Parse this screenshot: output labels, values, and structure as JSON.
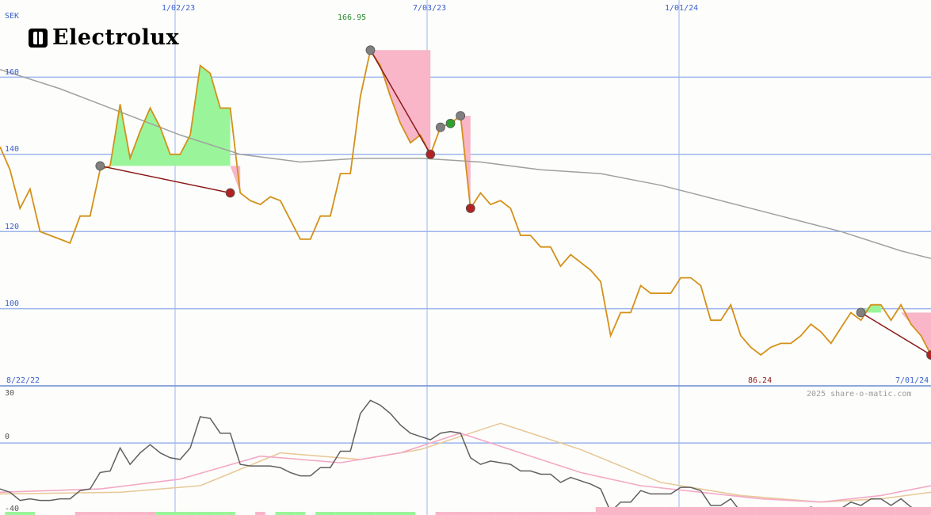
{
  "brand": {
    "name": "Electrolux"
  },
  "chart_data": [
    {
      "type": "line",
      "currency_label": "SEK",
      "x_dates": [
        "1/02/23",
        "7/03/23",
        "1/01/24"
      ],
      "start_date": "8/22/22",
      "end_date": "7/01/24",
      "max_label": "166.95",
      "min_label": "86.24",
      "watermark": "2025 share-o-matic.com",
      "ylim": [
        80,
        180
      ],
      "yticks": [
        160,
        140,
        120,
        100
      ],
      "price": [
        [
          0,
          142
        ],
        [
          1,
          136
        ],
        [
          2,
          126
        ],
        [
          3,
          131
        ],
        [
          4,
          120
        ],
        [
          5,
          119
        ],
        [
          6,
          118
        ],
        [
          7,
          117
        ],
        [
          8,
          124
        ],
        [
          9,
          124
        ],
        [
          10,
          136
        ],
        [
          11,
          137
        ],
        [
          12,
          153
        ],
        [
          13,
          139
        ],
        [
          14,
          146
        ],
        [
          15,
          152
        ],
        [
          16,
          147
        ],
        [
          17,
          140
        ],
        [
          18,
          140
        ],
        [
          19,
          145
        ],
        [
          20,
          163
        ],
        [
          21,
          161
        ],
        [
          22,
          152
        ],
        [
          23,
          152
        ],
        [
          24,
          130
        ],
        [
          25,
          128
        ],
        [
          26,
          127
        ],
        [
          27,
          129
        ],
        [
          28,
          128
        ],
        [
          29,
          123
        ],
        [
          30,
          118
        ],
        [
          31,
          118
        ],
        [
          32,
          124
        ],
        [
          33,
          124
        ],
        [
          34,
          135
        ],
        [
          35,
          135
        ],
        [
          36,
          155
        ],
        [
          37,
          167
        ],
        [
          38,
          163
        ],
        [
          39,
          155
        ],
        [
          40,
          148
        ],
        [
          41,
          143
        ],
        [
          42,
          145
        ],
        [
          43,
          140
        ],
        [
          44,
          147
        ],
        [
          45,
          148
        ],
        [
          46,
          150
        ],
        [
          47,
          126
        ],
        [
          48,
          130
        ],
        [
          49,
          127
        ],
        [
          50,
          128
        ],
        [
          51,
          126
        ],
        [
          52,
          119
        ],
        [
          53,
          119
        ],
        [
          54,
          116
        ],
        [
          55,
          116
        ],
        [
          56,
          111
        ],
        [
          57,
          114
        ],
        [
          58,
          112
        ],
        [
          59,
          110
        ],
        [
          60,
          107
        ],
        [
          61,
          93
        ],
        [
          62,
          99
        ],
        [
          63,
          99
        ],
        [
          64,
          106
        ],
        [
          65,
          104
        ],
        [
          66,
          104
        ],
        [
          67,
          104
        ],
        [
          68,
          108
        ],
        [
          69,
          108
        ],
        [
          70,
          106
        ],
        [
          71,
          97
        ],
        [
          72,
          97
        ],
        [
          73,
          101
        ],
        [
          74,
          93
        ],
        [
          75,
          90
        ],
        [
          76,
          88
        ],
        [
          77,
          90
        ],
        [
          78,
          91
        ],
        [
          79,
          91
        ],
        [
          80,
          93
        ],
        [
          81,
          96
        ],
        [
          82,
          94
        ],
        [
          83,
          91
        ],
        [
          84,
          95
        ],
        [
          85,
          99
        ],
        [
          86,
          97
        ],
        [
          87,
          101
        ],
        [
          88,
          101
        ],
        [
          89,
          97
        ],
        [
          90,
          101
        ],
        [
          91,
          96
        ],
        [
          92,
          93
        ],
        [
          93,
          88
        ]
      ],
      "moving_average": [
        [
          0,
          162
        ],
        [
          6,
          157
        ],
        [
          12,
          151
        ],
        [
          18,
          145
        ],
        [
          24,
          140
        ],
        [
          30,
          138
        ],
        [
          36,
          139
        ],
        [
          42,
          139
        ],
        [
          48,
          138
        ],
        [
          54,
          136
        ],
        [
          60,
          135
        ],
        [
          66,
          132
        ],
        [
          72,
          128
        ],
        [
          78,
          124
        ],
        [
          84,
          120
        ],
        [
          90,
          115
        ],
        [
          93,
          113
        ]
      ],
      "gain_regions": [
        {
          "x_start": 10,
          "x_end": 23,
          "baseline": 137
        },
        {
          "x_start": 86,
          "x_end": 88,
          "baseline": 99
        }
      ],
      "loss_regions": [
        {
          "x_start": 37,
          "x_end": 43,
          "top": 167
        },
        {
          "x_start": 46,
          "x_end": 47,
          "top": 150
        },
        {
          "x_start": 23,
          "x_end": 24,
          "top": 137
        },
        {
          "x_start": 90,
          "x_end": 93,
          "top": 99
        }
      ],
      "markers": [
        {
          "x": 10,
          "y": 137,
          "kind": "buy"
        },
        {
          "x": 23,
          "y": 130,
          "kind": "sell"
        },
        {
          "x": 37,
          "y": 167,
          "kind": "buy"
        },
        {
          "x": 43,
          "y": 140,
          "kind": "sell"
        },
        {
          "x": 44,
          "y": 147,
          "kind": "buy"
        },
        {
          "x": 45,
          "y": 148,
          "kind": "signal"
        },
        {
          "x": 46,
          "y": 150,
          "kind": "buy"
        },
        {
          "x": 47,
          "y": 126,
          "kind": "sell"
        },
        {
          "x": 86,
          "y": 99,
          "kind": "buy"
        },
        {
          "x": 93,
          "y": 88,
          "kind": "sell"
        }
      ],
      "trend_lines": [
        {
          "from": [
            10,
            137
          ],
          "to": [
            23,
            130
          ]
        },
        {
          "from": [
            37,
            167
          ],
          "to": [
            43,
            140
          ]
        },
        {
          "from": [
            86,
            99
          ],
          "to": [
            93,
            88
          ]
        }
      ]
    },
    {
      "type": "line",
      "ylim": [
        -40,
        30
      ],
      "yticks": [
        30,
        0,
        -40
      ],
      "oscillator": [
        [
          0,
          -28
        ],
        [
          1,
          -30
        ],
        [
          2,
          -35
        ],
        [
          3,
          -34
        ],
        [
          4,
          -35
        ],
        [
          5,
          -35
        ],
        [
          6,
          -34
        ],
        [
          7,
          -34
        ],
        [
          8,
          -29
        ],
        [
          9,
          -28
        ],
        [
          10,
          -18
        ],
        [
          11,
          -17
        ],
        [
          12,
          -3
        ],
        [
          13,
          -13
        ],
        [
          14,
          -6
        ],
        [
          15,
          -1
        ],
        [
          16,
          -6
        ],
        [
          17,
          -9
        ],
        [
          18,
          -10
        ],
        [
          19,
          -3
        ],
        [
          20,
          16
        ],
        [
          21,
          15
        ],
        [
          22,
          6
        ],
        [
          23,
          6
        ],
        [
          24,
          -13
        ],
        [
          25,
          -14
        ],
        [
          26,
          -14
        ],
        [
          27,
          -14
        ],
        [
          28,
          -15
        ],
        [
          29,
          -18
        ],
        [
          30,
          -20
        ],
        [
          31,
          -20
        ],
        [
          32,
          -15
        ],
        [
          33,
          -15
        ],
        [
          34,
          -5
        ],
        [
          35,
          -5
        ],
        [
          36,
          18
        ],
        [
          37,
          26
        ],
        [
          38,
          23
        ],
        [
          39,
          18
        ],
        [
          40,
          11
        ],
        [
          41,
          6
        ],
        [
          42,
          4
        ],
        [
          43,
          2
        ],
        [
          44,
          6
        ],
        [
          45,
          7
        ],
        [
          46,
          6
        ],
        [
          47,
          -9
        ],
        [
          48,
          -13
        ],
        [
          49,
          -11
        ],
        [
          50,
          -12
        ],
        [
          51,
          -13
        ],
        [
          52,
          -17
        ],
        [
          53,
          -17
        ],
        [
          54,
          -19
        ],
        [
          55,
          -19
        ],
        [
          56,
          -24
        ],
        [
          57,
          -21
        ],
        [
          58,
          -23
        ],
        [
          59,
          -25
        ],
        [
          60,
          -28
        ],
        [
          61,
          -42
        ],
        [
          62,
          -36
        ],
        [
          63,
          -36
        ],
        [
          64,
          -29
        ],
        [
          65,
          -31
        ],
        [
          66,
          -31
        ],
        [
          67,
          -31
        ],
        [
          68,
          -27
        ],
        [
          69,
          -27
        ],
        [
          70,
          -29
        ],
        [
          71,
          -38
        ],
        [
          72,
          -38
        ],
        [
          73,
          -34
        ],
        [
          74,
          -42
        ],
        [
          75,
          -45
        ],
        [
          76,
          -47
        ],
        [
          77,
          -45
        ],
        [
          78,
          -44
        ],
        [
          79,
          -44
        ],
        [
          80,
          -42
        ],
        [
          81,
          -39
        ],
        [
          82,
          -41
        ],
        [
          83,
          -44
        ],
        [
          84,
          -40
        ],
        [
          85,
          -36
        ],
        [
          86,
          -38
        ],
        [
          87,
          -34
        ],
        [
          88,
          -34
        ],
        [
          89,
          -38
        ],
        [
          90,
          -34
        ],
        [
          91,
          -39
        ],
        [
          92,
          -42
        ],
        [
          93,
          -47
        ]
      ],
      "signal_pink": [
        [
          0,
          -30
        ],
        [
          10,
          -28
        ],
        [
          18,
          -22
        ],
        [
          26,
          -8
        ],
        [
          34,
          -12
        ],
        [
          40,
          -6
        ],
        [
          46,
          6
        ],
        [
          52,
          -6
        ],
        [
          58,
          -18
        ],
        [
          64,
          -26
        ],
        [
          70,
          -30
        ],
        [
          76,
          -34
        ],
        [
          82,
          -36
        ],
        [
          88,
          -32
        ],
        [
          93,
          -26
        ]
      ],
      "signal_tan": [
        [
          0,
          -31
        ],
        [
          12,
          -30
        ],
        [
          20,
          -26
        ],
        [
          28,
          -6
        ],
        [
          36,
          -10
        ],
        [
          42,
          -4
        ],
        [
          50,
          12
        ],
        [
          58,
          -4
        ],
        [
          66,
          -24
        ],
        [
          74,
          -32
        ],
        [
          82,
          -36
        ],
        [
          88,
          -34
        ],
        [
          93,
          -30
        ]
      ],
      "histogram_green_x": [
        1,
        2,
        3,
        16,
        17,
        18,
        19,
        20,
        21,
        22,
        23,
        28,
        29,
        30,
        32,
        33,
        34,
        35,
        36,
        37,
        38,
        39,
        40,
        41
      ],
      "histogram_pink_x": [
        8,
        9,
        10,
        11,
        12,
        13,
        14,
        15,
        26,
        44,
        45,
        46,
        47,
        48,
        49,
        50,
        51,
        52,
        53,
        54,
        55,
        56,
        57,
        58,
        59,
        60,
        61,
        62,
        63,
        64,
        65,
        66,
        67,
        68,
        69,
        70,
        71,
        72,
        73,
        74,
        75,
        76,
        77,
        78,
        79,
        80,
        81,
        82,
        83,
        84,
        85,
        86,
        87,
        88,
        89,
        90,
        91,
        92,
        93
      ]
    }
  ]
}
